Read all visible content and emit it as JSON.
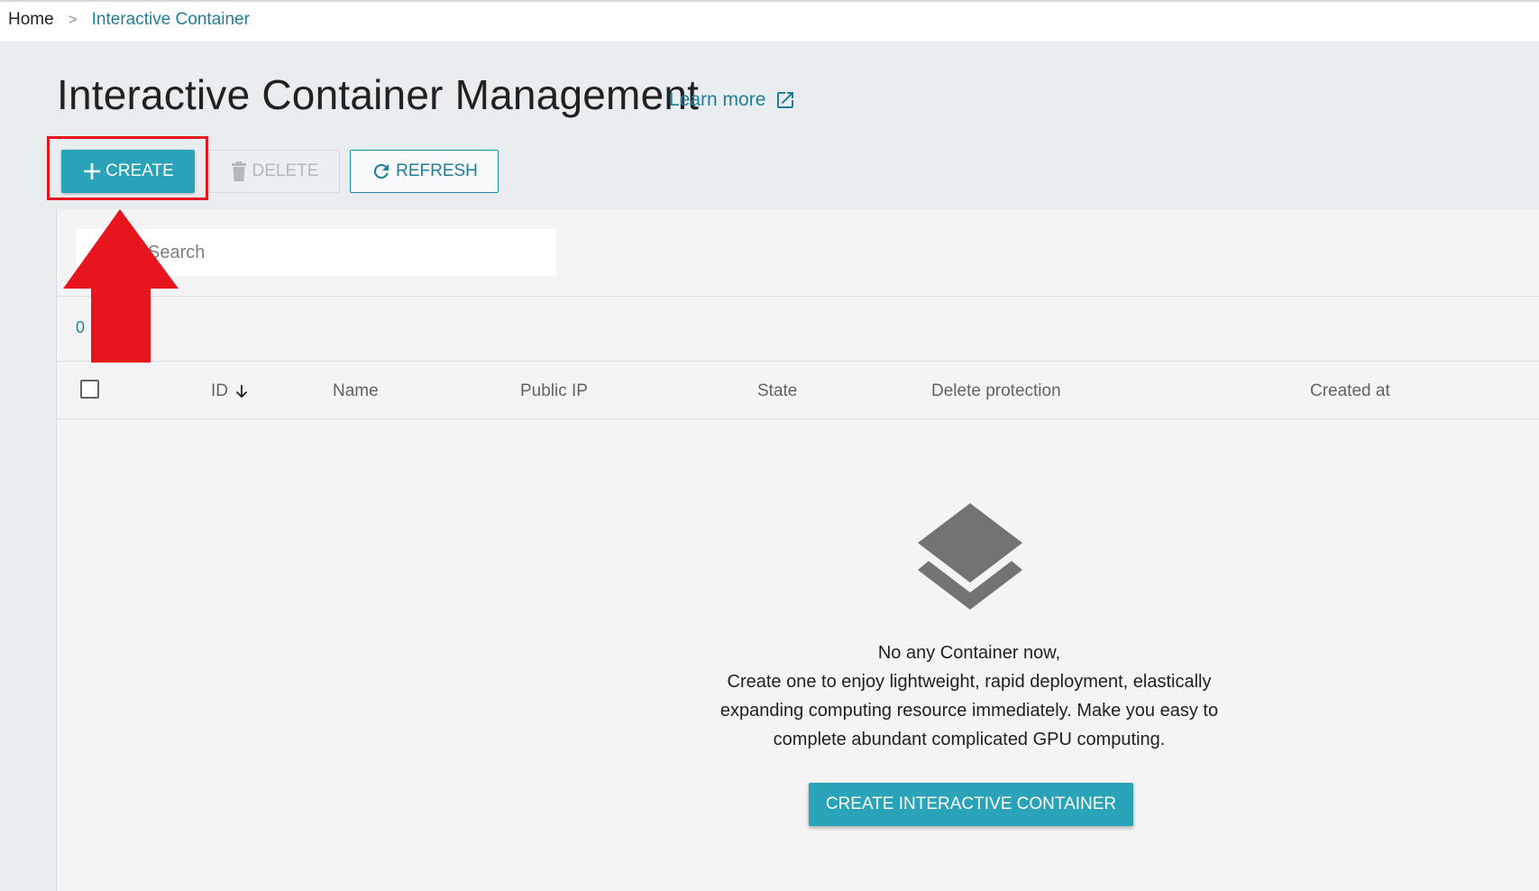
{
  "breadcrumb": {
    "home": "Home",
    "separator": ">",
    "current": "Interactive Container"
  },
  "page": {
    "title": "Interactive Container Management",
    "learn_more": "Learn more"
  },
  "toolbar": {
    "create_label": "CREATE",
    "delete_label": "DELETE",
    "refresh_label": "REFRESH"
  },
  "search": {
    "placeholder": "Search"
  },
  "list": {
    "count": "0"
  },
  "table": {
    "columns": [
      "ID",
      "Name",
      "Public IP",
      "State",
      "Delete protection",
      "Created at"
    ],
    "rows": []
  },
  "empty_state": {
    "line1": "No any Container now,",
    "line2": "Create one to enjoy lightweight, rapid deployment, elastically",
    "line3": "expanding computing resource immediately. Make you easy to",
    "line4": "complete abundant complicated GPU computing.",
    "button_label": "CREATE INTERACTIVE CONTAINER"
  },
  "colors": {
    "accent": "#2aa3b9",
    "link": "#1f7e9a",
    "annotation_red": "#e8141e",
    "background": "#e9edf0"
  },
  "icons": {
    "create": "plus-icon",
    "delete": "trash-icon",
    "refresh": "refresh-icon",
    "learn_more": "external-link-icon",
    "sort": "arrow-down-icon",
    "empty": "layers-icon"
  }
}
